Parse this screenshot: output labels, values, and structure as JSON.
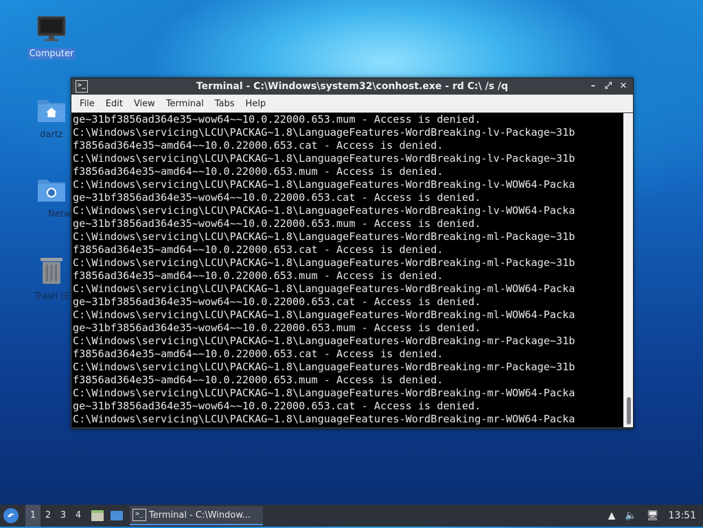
{
  "desktop": {
    "icons": [
      {
        "label": "Computer",
        "icon": "monitor-icon"
      },
      {
        "label": "dartz",
        "icon": "home-folder-icon"
      },
      {
        "label": "Network",
        "icon": "network-folder-icon"
      },
      {
        "label": "Trash (Empty)",
        "icon": "trash-icon"
      }
    ]
  },
  "window": {
    "title": "Terminal - C:\\Windows\\system32\\conhost.exe - rd  C:\\ /s /q",
    "app_icon_glyph": ">_",
    "controls": {
      "minimize": "–",
      "maximize": "⤢",
      "close": "✕"
    },
    "menu": [
      "File",
      "Edit",
      "View",
      "Terminal",
      "Tabs",
      "Help"
    ],
    "terminal_text": "ge~31bf3856ad364e35~wow64~~10.0.22000.653.mum - Access is denied.\nC:\\Windows\\servicing\\LCU\\PACKAG~1.8\\LanguageFeatures-WordBreaking-lv-Package~31b\nf3856ad364e35~amd64~~10.0.22000.653.cat - Access is denied.\nC:\\Windows\\servicing\\LCU\\PACKAG~1.8\\LanguageFeatures-WordBreaking-lv-Package~31b\nf3856ad364e35~amd64~~10.0.22000.653.mum - Access is denied.\nC:\\Windows\\servicing\\LCU\\PACKAG~1.8\\LanguageFeatures-WordBreaking-lv-WOW64-Packa\nge~31bf3856ad364e35~wow64~~10.0.22000.653.cat - Access is denied.\nC:\\Windows\\servicing\\LCU\\PACKAG~1.8\\LanguageFeatures-WordBreaking-lv-WOW64-Packa\nge~31bf3856ad364e35~wow64~~10.0.22000.653.mum - Access is denied.\nC:\\Windows\\servicing\\LCU\\PACKAG~1.8\\LanguageFeatures-WordBreaking-ml-Package~31b\nf3856ad364e35~amd64~~10.0.22000.653.cat - Access is denied.\nC:\\Windows\\servicing\\LCU\\PACKAG~1.8\\LanguageFeatures-WordBreaking-ml-Package~31b\nf3856ad364e35~amd64~~10.0.22000.653.mum - Access is denied.\nC:\\Windows\\servicing\\LCU\\PACKAG~1.8\\LanguageFeatures-WordBreaking-ml-WOW64-Packa\nge~31bf3856ad364e35~wow64~~10.0.22000.653.cat - Access is denied.\nC:\\Windows\\servicing\\LCU\\PACKAG~1.8\\LanguageFeatures-WordBreaking-ml-WOW64-Packa\nge~31bf3856ad364e35~wow64~~10.0.22000.653.mum - Access is denied.\nC:\\Windows\\servicing\\LCU\\PACKAG~1.8\\LanguageFeatures-WordBreaking-mr-Package~31b\nf3856ad364e35~amd64~~10.0.22000.653.cat - Access is denied.\nC:\\Windows\\servicing\\LCU\\PACKAG~1.8\\LanguageFeatures-WordBreaking-mr-Package~31b\nf3856ad364e35~amd64~~10.0.22000.653.mum - Access is denied.\nC:\\Windows\\servicing\\LCU\\PACKAG~1.8\\LanguageFeatures-WordBreaking-mr-WOW64-Packa\nge~31bf3856ad364e35~wow64~~10.0.22000.653.cat - Access is denied.\nC:\\Windows\\servicing\\LCU\\PACKAG~1.8\\LanguageFeatures-WordBreaking-mr-WOW64-Packa"
  },
  "taskbar": {
    "workspaces": [
      "1",
      "2",
      "3",
      "4"
    ],
    "active_workspace": "1",
    "task_label": "Terminal - C:\\Window...",
    "task_icon_glyph": ">_",
    "clock": "13:51",
    "accent": "#5294e2"
  }
}
